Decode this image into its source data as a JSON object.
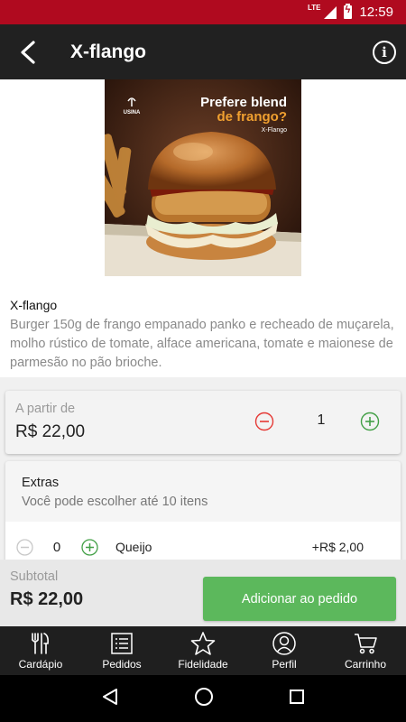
{
  "statusbar": {
    "network": "LTE",
    "time": "12:59"
  },
  "appbar": {
    "title": "X-flango"
  },
  "product_image": {
    "headline_line1": "Prefere blend",
    "headline_line2": "de frango?",
    "subtitle": "X-Flango",
    "logo_text": "USINA"
  },
  "product": {
    "name": "X-flango",
    "description": "Burger 150g de frango empanado panko e recheado de muçarela, molho rústico de tomate, alface americana, tomate e maionese de parmesão no pão brioche."
  },
  "price_card": {
    "from_label": "A partir de",
    "price": "R$ 22,00",
    "quantity": "1"
  },
  "extras": {
    "title": "Extras",
    "subtitle": "Você pode escolher até 10 itens",
    "items": [
      {
        "quantity": "0",
        "name": "Queijo",
        "price": "+R$ 2,00"
      }
    ]
  },
  "footer": {
    "subtotal_label": "Subtotal",
    "subtotal_value": "R$ 22,00",
    "add_button": "Adicionar ao pedido"
  },
  "bottom_nav": [
    {
      "label": "Cardápio",
      "icon": "cutlery-icon"
    },
    {
      "label": "Pedidos",
      "icon": "list-icon"
    },
    {
      "label": "Fidelidade",
      "icon": "star-icon"
    },
    {
      "label": "Perfil",
      "icon": "profile-icon"
    },
    {
      "label": "Carrinho",
      "icon": "cart-icon"
    }
  ],
  "colors": {
    "statusbar": "#b00a1f",
    "appbar": "#212121",
    "accent_green": "#5cb85c",
    "minus_red": "#e53935"
  }
}
